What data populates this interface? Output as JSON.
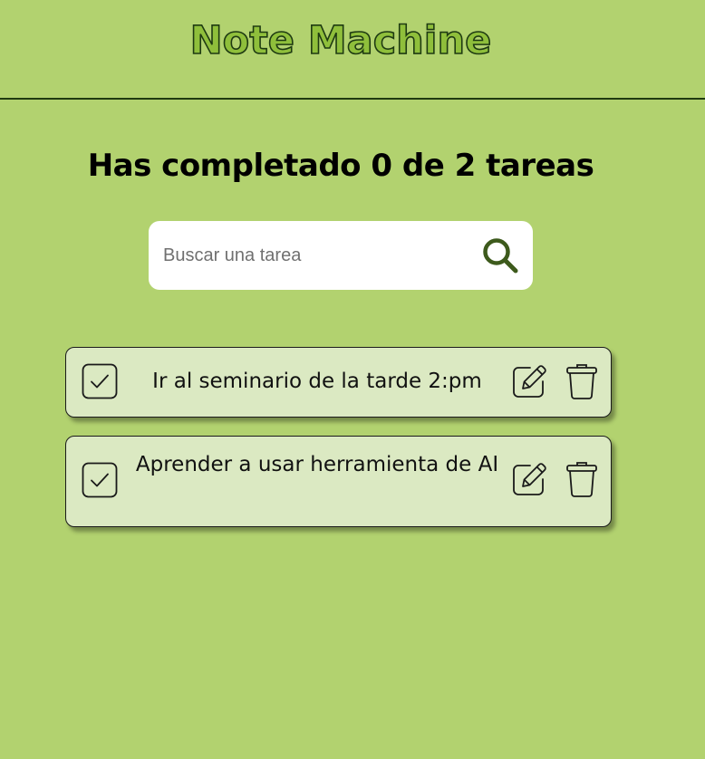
{
  "header": {
    "title": "Note Machine"
  },
  "counter": {
    "text": "Has completado 0 de 2 tareas"
  },
  "search": {
    "placeholder": "Buscar una tarea",
    "value": "",
    "icon": "search-icon"
  },
  "todos": [
    {
      "text": "Ir al seminario de la tarde 2:pm",
      "completed": false,
      "icons": [
        "check-icon",
        "edit-icon",
        "trash-icon"
      ]
    },
    {
      "text": "Aprender a usar herramienta de AI",
      "completed": false,
      "icons": [
        "check-icon",
        "edit-icon",
        "trash-icon"
      ]
    }
  ],
  "colors": {
    "background": "#b2d26f",
    "title_fill": "#8fbf3b",
    "title_stroke": "#1e3a12",
    "card_background": "#dbe9c2",
    "search_icon": "#3d5a1c"
  }
}
